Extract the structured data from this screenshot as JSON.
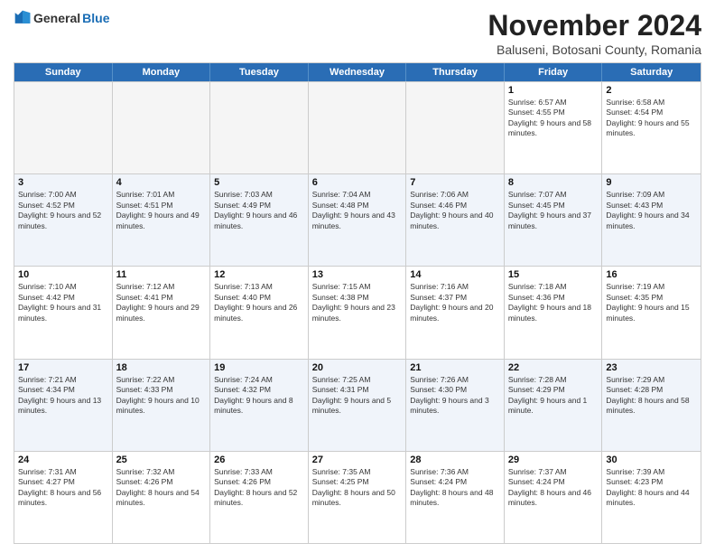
{
  "logo": {
    "general": "General",
    "blue": "Blue"
  },
  "title": "November 2024",
  "subtitle": "Baluseni, Botosani County, Romania",
  "days": [
    "Sunday",
    "Monday",
    "Tuesday",
    "Wednesday",
    "Thursday",
    "Friday",
    "Saturday"
  ],
  "rows": [
    [
      {
        "num": "",
        "info": "",
        "empty": true
      },
      {
        "num": "",
        "info": "",
        "empty": true
      },
      {
        "num": "",
        "info": "",
        "empty": true
      },
      {
        "num": "",
        "info": "",
        "empty": true
      },
      {
        "num": "",
        "info": "",
        "empty": true
      },
      {
        "num": "1",
        "info": "Sunrise: 6:57 AM\nSunset: 4:55 PM\nDaylight: 9 hours and 58 minutes.",
        "empty": false
      },
      {
        "num": "2",
        "info": "Sunrise: 6:58 AM\nSunset: 4:54 PM\nDaylight: 9 hours and 55 minutes.",
        "empty": false
      }
    ],
    [
      {
        "num": "3",
        "info": "Sunrise: 7:00 AM\nSunset: 4:52 PM\nDaylight: 9 hours and 52 minutes.",
        "empty": false
      },
      {
        "num": "4",
        "info": "Sunrise: 7:01 AM\nSunset: 4:51 PM\nDaylight: 9 hours and 49 minutes.",
        "empty": false
      },
      {
        "num": "5",
        "info": "Sunrise: 7:03 AM\nSunset: 4:49 PM\nDaylight: 9 hours and 46 minutes.",
        "empty": false
      },
      {
        "num": "6",
        "info": "Sunrise: 7:04 AM\nSunset: 4:48 PM\nDaylight: 9 hours and 43 minutes.",
        "empty": false
      },
      {
        "num": "7",
        "info": "Sunrise: 7:06 AM\nSunset: 4:46 PM\nDaylight: 9 hours and 40 minutes.",
        "empty": false
      },
      {
        "num": "8",
        "info": "Sunrise: 7:07 AM\nSunset: 4:45 PM\nDaylight: 9 hours and 37 minutes.",
        "empty": false
      },
      {
        "num": "9",
        "info": "Sunrise: 7:09 AM\nSunset: 4:43 PM\nDaylight: 9 hours and 34 minutes.",
        "empty": false
      }
    ],
    [
      {
        "num": "10",
        "info": "Sunrise: 7:10 AM\nSunset: 4:42 PM\nDaylight: 9 hours and 31 minutes.",
        "empty": false
      },
      {
        "num": "11",
        "info": "Sunrise: 7:12 AM\nSunset: 4:41 PM\nDaylight: 9 hours and 29 minutes.",
        "empty": false
      },
      {
        "num": "12",
        "info": "Sunrise: 7:13 AM\nSunset: 4:40 PM\nDaylight: 9 hours and 26 minutes.",
        "empty": false
      },
      {
        "num": "13",
        "info": "Sunrise: 7:15 AM\nSunset: 4:38 PM\nDaylight: 9 hours and 23 minutes.",
        "empty": false
      },
      {
        "num": "14",
        "info": "Sunrise: 7:16 AM\nSunset: 4:37 PM\nDaylight: 9 hours and 20 minutes.",
        "empty": false
      },
      {
        "num": "15",
        "info": "Sunrise: 7:18 AM\nSunset: 4:36 PM\nDaylight: 9 hours and 18 minutes.",
        "empty": false
      },
      {
        "num": "16",
        "info": "Sunrise: 7:19 AM\nSunset: 4:35 PM\nDaylight: 9 hours and 15 minutes.",
        "empty": false
      }
    ],
    [
      {
        "num": "17",
        "info": "Sunrise: 7:21 AM\nSunset: 4:34 PM\nDaylight: 9 hours and 13 minutes.",
        "empty": false
      },
      {
        "num": "18",
        "info": "Sunrise: 7:22 AM\nSunset: 4:33 PM\nDaylight: 9 hours and 10 minutes.",
        "empty": false
      },
      {
        "num": "19",
        "info": "Sunrise: 7:24 AM\nSunset: 4:32 PM\nDaylight: 9 hours and 8 minutes.",
        "empty": false
      },
      {
        "num": "20",
        "info": "Sunrise: 7:25 AM\nSunset: 4:31 PM\nDaylight: 9 hours and 5 minutes.",
        "empty": false
      },
      {
        "num": "21",
        "info": "Sunrise: 7:26 AM\nSunset: 4:30 PM\nDaylight: 9 hours and 3 minutes.",
        "empty": false
      },
      {
        "num": "22",
        "info": "Sunrise: 7:28 AM\nSunset: 4:29 PM\nDaylight: 9 hours and 1 minute.",
        "empty": false
      },
      {
        "num": "23",
        "info": "Sunrise: 7:29 AM\nSunset: 4:28 PM\nDaylight: 8 hours and 58 minutes.",
        "empty": false
      }
    ],
    [
      {
        "num": "24",
        "info": "Sunrise: 7:31 AM\nSunset: 4:27 PM\nDaylight: 8 hours and 56 minutes.",
        "empty": false
      },
      {
        "num": "25",
        "info": "Sunrise: 7:32 AM\nSunset: 4:26 PM\nDaylight: 8 hours and 54 minutes.",
        "empty": false
      },
      {
        "num": "26",
        "info": "Sunrise: 7:33 AM\nSunset: 4:26 PM\nDaylight: 8 hours and 52 minutes.",
        "empty": false
      },
      {
        "num": "27",
        "info": "Sunrise: 7:35 AM\nSunset: 4:25 PM\nDaylight: 8 hours and 50 minutes.",
        "empty": false
      },
      {
        "num": "28",
        "info": "Sunrise: 7:36 AM\nSunset: 4:24 PM\nDaylight: 8 hours and 48 minutes.",
        "empty": false
      },
      {
        "num": "29",
        "info": "Sunrise: 7:37 AM\nSunset: 4:24 PM\nDaylight: 8 hours and 46 minutes.",
        "empty": false
      },
      {
        "num": "30",
        "info": "Sunrise: 7:39 AM\nSunset: 4:23 PM\nDaylight: 8 hours and 44 minutes.",
        "empty": false
      }
    ]
  ],
  "alt_rows": [
    1,
    3
  ]
}
